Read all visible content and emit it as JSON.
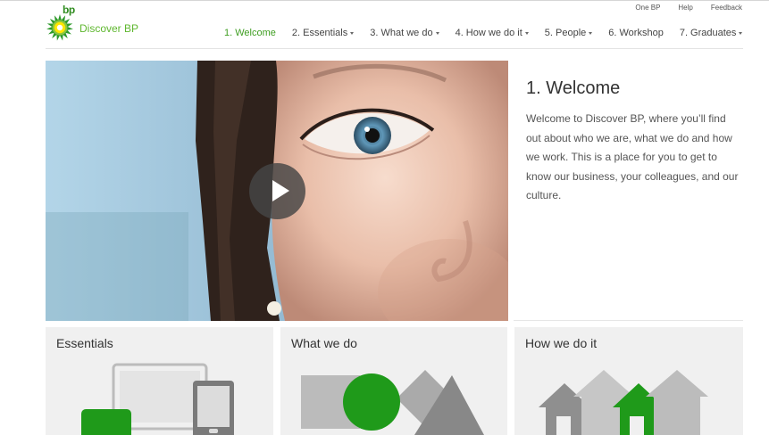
{
  "utility_links": [
    "One BP",
    "Help",
    "Feedback"
  ],
  "logo": {
    "word": "bp",
    "brand": "Discover BP"
  },
  "nav": [
    {
      "label": "1. Welcome",
      "active": true,
      "dropdown": false
    },
    {
      "label": "2. Essentials",
      "active": false,
      "dropdown": true
    },
    {
      "label": "3. What we do",
      "active": false,
      "dropdown": true
    },
    {
      "label": "4. How we do it",
      "active": false,
      "dropdown": true
    },
    {
      "label": "5. People",
      "active": false,
      "dropdown": true
    },
    {
      "label": "6. Workshop",
      "active": false,
      "dropdown": false
    },
    {
      "label": "7. Graduates",
      "active": false,
      "dropdown": true
    }
  ],
  "intro": {
    "title": "1. Welcome",
    "body": "Welcome to Discover BP, where you’ll find out about who we are, what we do and how we work. This is a place for you to get to know our business, your colleagues, and our culture."
  },
  "cards": [
    {
      "title": "Essentials",
      "icon": "devices-icon"
    },
    {
      "title": "What we do",
      "icon": "shapes-icon"
    },
    {
      "title": "How we do it",
      "icon": "houses-icon"
    }
  ],
  "colors": {
    "accent_green": "#3f9e22",
    "logo_green": "#5fb72f",
    "card_bg": "#f0f0f0",
    "icon_green": "#1f9a1a"
  }
}
